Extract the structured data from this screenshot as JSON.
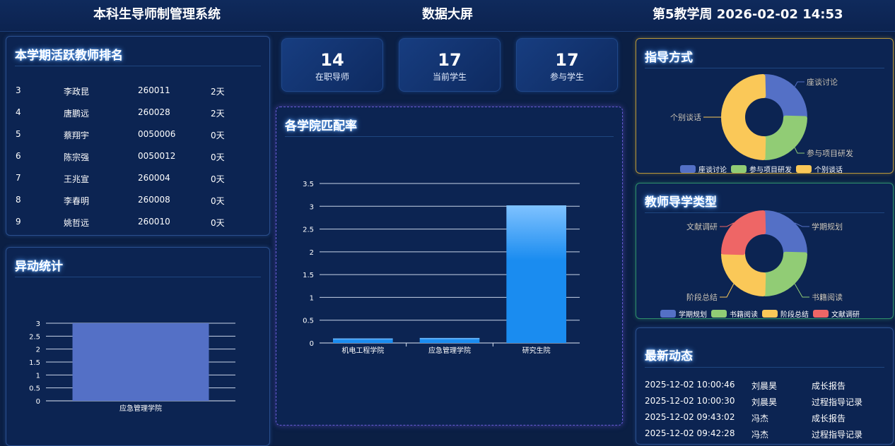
{
  "header": {
    "system_title": "本科生导师制管理系统",
    "screen_title": "数据大屏",
    "week_datetime": "第5教学周 2026-02-02 14:53"
  },
  "ranking": {
    "title": "本学期活跃教师排名",
    "rows": [
      {
        "rank": "3",
        "name": "李政昆",
        "id": "260011",
        "days": "2天"
      },
      {
        "rank": "4",
        "name": "唐鹏远",
        "id": "260028",
        "days": "2天"
      },
      {
        "rank": "5",
        "name": "蔡翔宇",
        "id": "0050006",
        "days": "0天"
      },
      {
        "rank": "6",
        "name": "陈宗强",
        "id": "0050012",
        "days": "0天"
      },
      {
        "rank": "7",
        "name": "王兆宣",
        "id": "260004",
        "days": "0天"
      },
      {
        "rank": "8",
        "name": "李春明",
        "id": "260008",
        "days": "0天"
      },
      {
        "rank": "9",
        "name": "姚哲远",
        "id": "260010",
        "days": "0天"
      }
    ]
  },
  "stats": [
    {
      "value": "14",
      "label": "在职导师"
    },
    {
      "value": "17",
      "label": "当前学生"
    },
    {
      "value": "17",
      "label": "参与学生"
    }
  ],
  "anomaly": {
    "title": "异动统计"
  },
  "match_rate": {
    "title": "各学院匹配率"
  },
  "guidance": {
    "title": "指导方式"
  },
  "teach_type": {
    "title": "教师导学类型"
  },
  "news": {
    "title": "最新动态",
    "rows": [
      {
        "time": "2025-12-02 10:00:46",
        "person": "刘晨昊",
        "type": "成长报告"
      },
      {
        "time": "2025-12-02 10:00:30",
        "person": "刘晨昊",
        "type": "过程指导记录"
      },
      {
        "time": "2025-12-02 09:43:02",
        "person": "冯杰",
        "type": "成长报告"
      },
      {
        "time": "2025-12-02 09:42:28",
        "person": "冯杰",
        "type": "过程指导记录"
      }
    ]
  },
  "colors": {
    "blue": "#5470c6",
    "green": "#91cc75",
    "yellow": "#fac858",
    "red": "#ee6666",
    "bar_blue": "#1a8cf0"
  },
  "chart_data": [
    {
      "type": "bar",
      "title": "异动统计",
      "categories": [
        "应急管理学院"
      ],
      "values": [
        3
      ],
      "ylim": [
        0,
        3
      ],
      "yticks": [
        "0",
        "0.5",
        "1",
        "1.5",
        "2",
        "2.5",
        "3"
      ]
    },
    {
      "type": "bar",
      "title": "各学院匹配率",
      "categories": [
        "机电工程学院",
        "应急管理学院",
        "研究生院"
      ],
      "values": [
        0.1,
        0.11,
        3.02
      ],
      "ylim": [
        0,
        3.5
      ],
      "yticks": [
        "0",
        "0.5",
        "1",
        "1.5",
        "2",
        "2.5",
        "3",
        "3.5"
      ]
    },
    {
      "type": "pie",
      "title": "指导方式",
      "labels": [
        "座谈讨论",
        "参与项目研发",
        "个别谈话"
      ],
      "values": [
        1,
        1,
        2
      ],
      "legend": [
        "座谈讨论",
        "参与项目研发",
        "个别谈话"
      ]
    },
    {
      "type": "pie",
      "title": "教师导学类型",
      "labels": [
        "学期规划",
        "书籍阅读",
        "阶段总结",
        "文献调研"
      ],
      "values": [
        1,
        1,
        1,
        1
      ],
      "legend": [
        "学期规划",
        "书籍阅读",
        "阶段总结",
        "文献调研"
      ]
    }
  ]
}
